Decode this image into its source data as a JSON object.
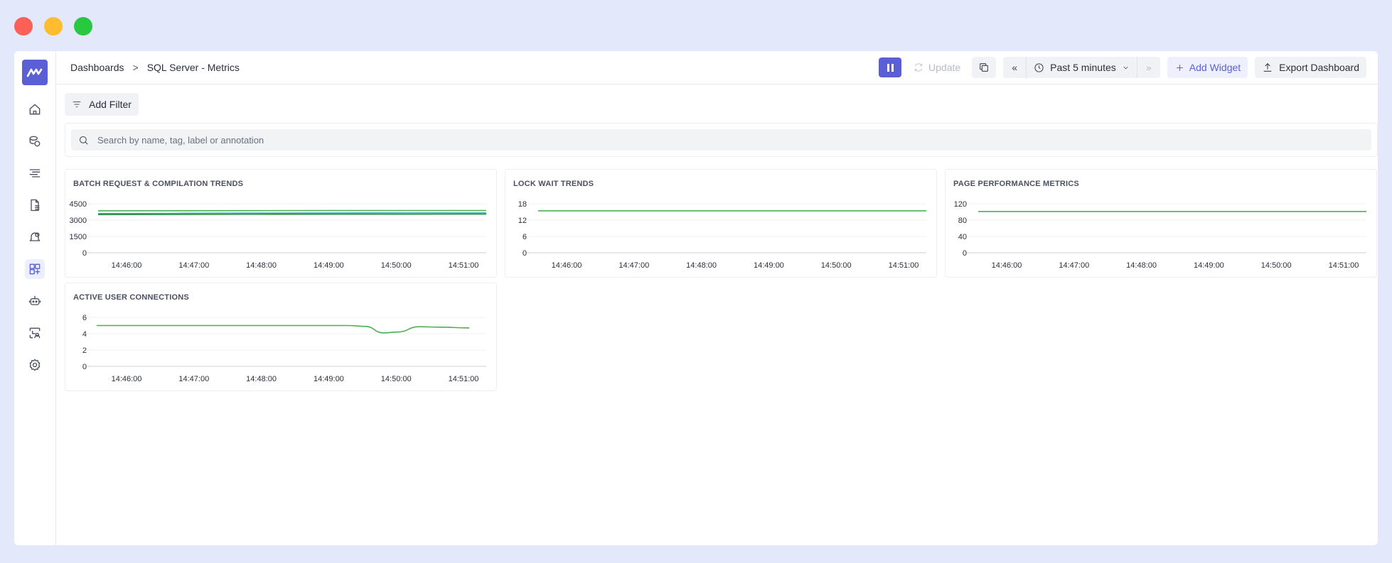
{
  "breadcrumb": {
    "root": "Dashboards",
    "separator": ">",
    "current": "SQL Server - Metrics"
  },
  "toolbar": {
    "update_label": "Update",
    "time_range": "Past 5 minutes",
    "add_widget_label": "Add Widget",
    "export_label": "Export Dashboard",
    "prev_glyph": "«",
    "next_glyph": "»"
  },
  "filter": {
    "add_filter_label": "Add Filter"
  },
  "search": {
    "placeholder": "Search by name, tag, label or annotation"
  },
  "colors": {
    "accent": "#5a5fd6",
    "series_green": "#4caf50",
    "series_teal": "#2aa8a0"
  },
  "sidebar": {
    "items": [
      {
        "icon": "home-icon"
      },
      {
        "icon": "infrastructure-icon"
      },
      {
        "icon": "logs-icon"
      },
      {
        "icon": "reports-icon"
      },
      {
        "icon": "alerts-icon"
      },
      {
        "icon": "dashboards-icon",
        "active": true
      },
      {
        "icon": "ai-bot-icon"
      },
      {
        "icon": "synthetics-icon"
      },
      {
        "icon": "settings-icon"
      }
    ]
  },
  "chart_data": [
    {
      "type": "line",
      "title": "BATCH REQUEST & COMPILATION TRENDS",
      "x": [
        "14:46:00",
        "14:47:00",
        "14:48:00",
        "14:49:00",
        "14:50:00",
        "14:51:00"
      ],
      "yticks": [
        0,
        1500,
        3000,
        4500
      ],
      "ylim": [
        0,
        4500
      ],
      "series": [
        {
          "color": "#4caf50",
          "values": [
            3850,
            3860,
            3870,
            3880,
            3880,
            3880
          ]
        },
        {
          "color": "#2aa8a0",
          "values": [
            3600,
            3620,
            3640,
            3650,
            3660,
            3660
          ]
        },
        {
          "color": "#2f8f4f",
          "values": [
            3500,
            3520,
            3530,
            3540,
            3545,
            3550
          ]
        }
      ]
    },
    {
      "type": "line",
      "title": "LOCK WAIT TRENDS",
      "x": [
        "14:46:00",
        "14:47:00",
        "14:48:00",
        "14:49:00",
        "14:50:00",
        "14:51:00"
      ],
      "yticks": [
        0,
        6,
        12,
        18
      ],
      "ylim": [
        0,
        18
      ],
      "series": [
        {
          "color": "#4caf50",
          "values": [
            15.4,
            15.4,
            15.4,
            15.4,
            15.4,
            15.4
          ]
        }
      ]
    },
    {
      "type": "line",
      "title": "PAGE PERFORMANCE METRICS",
      "x": [
        "14:46:00",
        "14:47:00",
        "14:48:00",
        "14:49:00",
        "14:50:00",
        "14:51:00"
      ],
      "yticks": [
        0,
        40,
        80,
        120
      ],
      "ylim": [
        0,
        120
      ],
      "series": [
        {
          "color": "#4caf50",
          "values": [
            101,
            101,
            101,
            101,
            101,
            101
          ]
        }
      ]
    },
    {
      "type": "line",
      "title": "ACTIVE USER CONNECTIONS",
      "x": [
        "14:46:00",
        "14:47:00",
        "14:48:00",
        "14:49:00",
        "14:50:00",
        "14:51:00"
      ],
      "yticks": [
        0,
        2,
        4,
        6
      ],
      "ylim": [
        0,
        6
      ],
      "series": [
        {
          "color": "#4caf50",
          "smooth": true,
          "points": [
            [
              0,
              5
            ],
            [
              0.5,
              5
            ],
            [
              1,
              5
            ],
            [
              1.5,
              5
            ],
            [
              2,
              5
            ],
            [
              2.5,
              5
            ],
            [
              3,
              5
            ],
            [
              3.5,
              5
            ],
            [
              3.75,
              4.9
            ],
            [
              4,
              4.1
            ],
            [
              4.2,
              4.2
            ],
            [
              4.5,
              4.85
            ],
            [
              4.8,
              4.8
            ],
            [
              5.2,
              4.7
            ]
          ]
        }
      ]
    }
  ]
}
